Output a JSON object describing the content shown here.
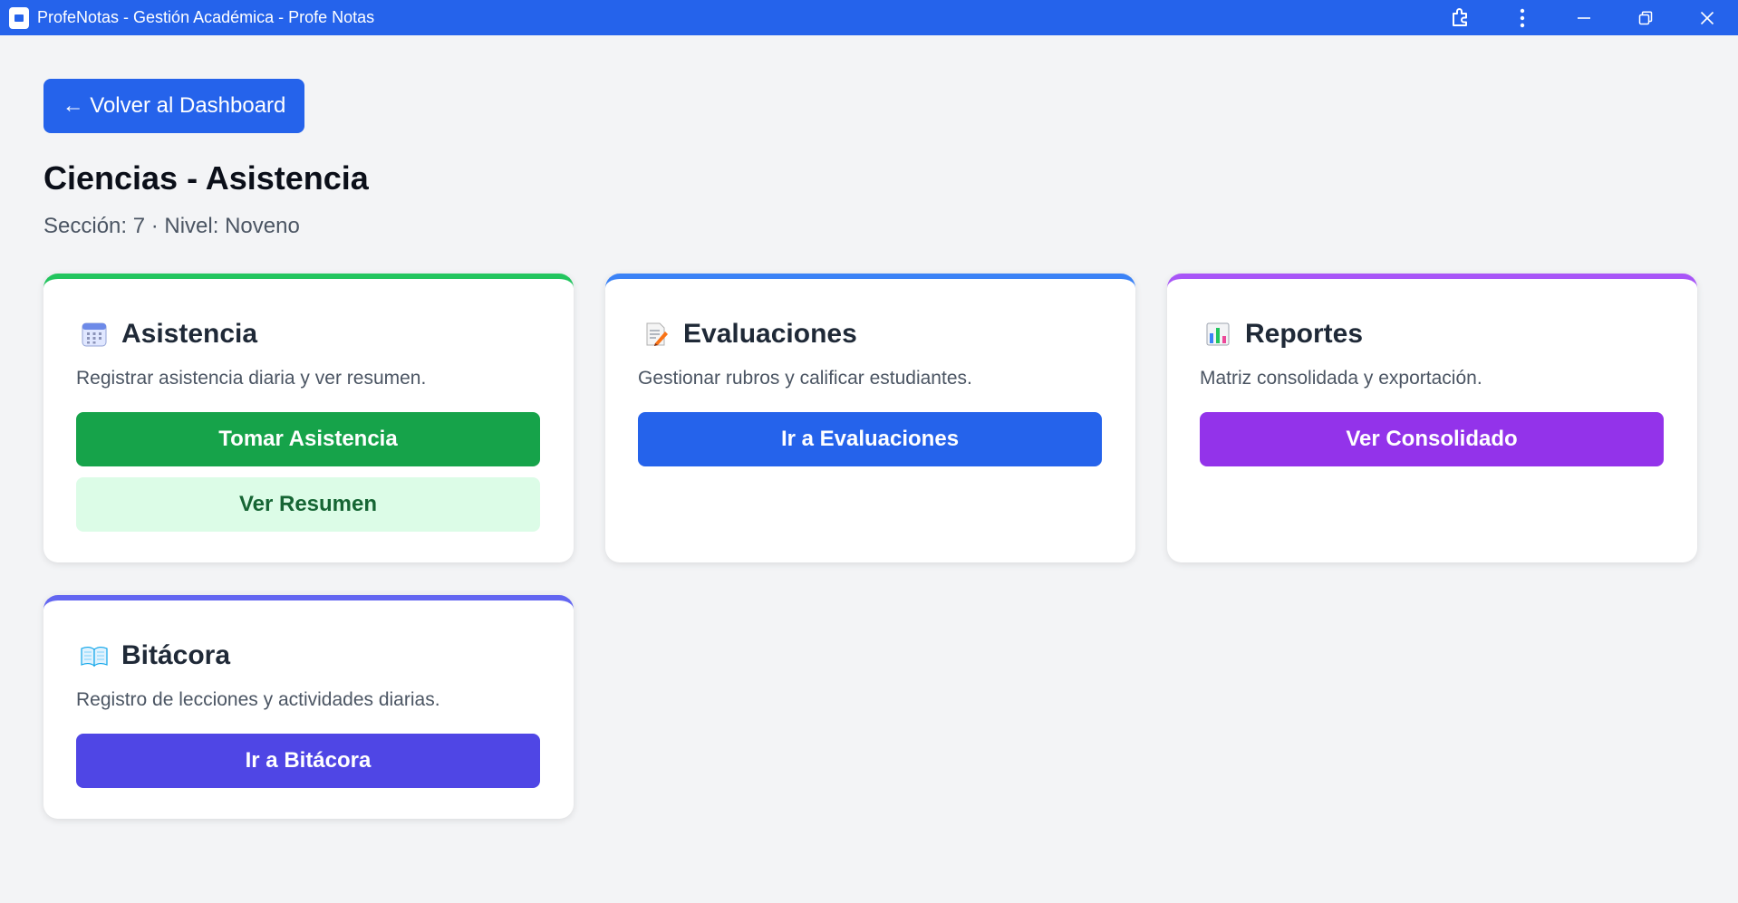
{
  "window": {
    "title": "ProfeNotas - Gestión Académica - Profe Notas",
    "controls": [
      "extensions-icon",
      "more-vertical-icon",
      "minimize-icon",
      "restore-icon",
      "close-icon"
    ]
  },
  "header": {
    "back_label": "← Volver al Dashboard",
    "title": "Ciencias - Asistencia",
    "subtitle": "Sección: 7 · Nivel: Noveno"
  },
  "cards": [
    {
      "icon": "calendar-icon",
      "title": "Asistencia",
      "description": "Registrar asistencia diaria y ver resumen.",
      "accent": "#22c55e",
      "primary_label": "Tomar Asistencia",
      "primary_color": "#16a34a",
      "secondary_label": "Ver Resumen",
      "secondary_color": "#dcfce7",
      "secondary_text_color": "#166534"
    },
    {
      "icon": "memo-icon",
      "title": "Evaluaciones",
      "description": "Gestionar rubros y calificar estudiantes.",
      "accent": "#3b82f6",
      "primary_label": "Ir a Evaluaciones",
      "primary_color": "#2563eb"
    },
    {
      "icon": "bar-chart-icon",
      "title": "Reportes",
      "description": "Matriz consolidada y exportación.",
      "accent": "#a855f7",
      "primary_label": "Ver Consolidado",
      "primary_color": "#9333ea"
    },
    {
      "icon": "open-book-icon",
      "title": "Bitácora",
      "description": "Registro de lecciones y actividades diarias.",
      "accent": "#6366f1",
      "primary_label": "Ir a Bitácora",
      "primary_color": "#4f46e5"
    }
  ],
  "colors": {
    "titlebar": "#2563eb",
    "background": "#f3f4f6"
  }
}
